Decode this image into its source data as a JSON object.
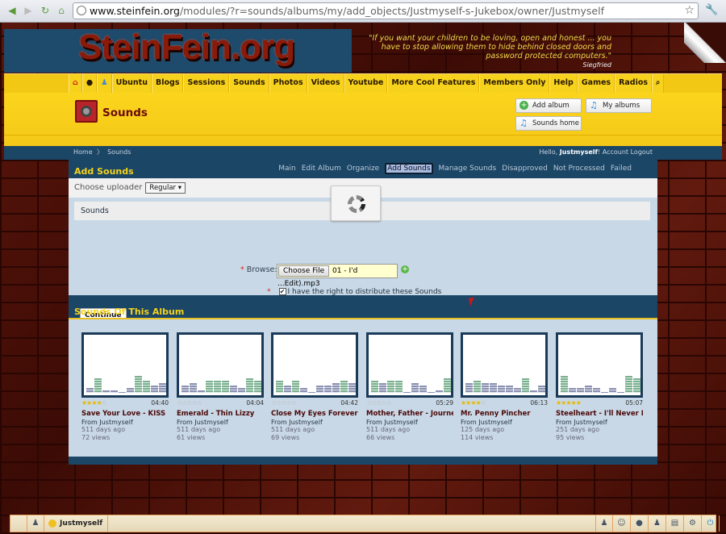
{
  "browser": {
    "url_domain": "www.steinfein.org",
    "url_path": "/modules/?r=sounds/albums/my/add_objects/Justmyself-s-Jukebox/owner/Justmyself"
  },
  "site": {
    "logo": "SteinFein.org",
    "quote": "\"If you want your children to be loving, open and honest ... you have to stop allowing them to hide behind closed doors and password protected computers.\"",
    "quote_author": "Siegfried"
  },
  "nav": [
    "Ubuntu",
    "Blogs",
    "Sessions",
    "Sounds",
    "Photos",
    "Videos",
    "Youtube",
    "More Cool Features",
    "Members Only",
    "Help",
    "Games",
    "Radios"
  ],
  "page": {
    "title": "Sounds",
    "add_album": "Add album",
    "my_albums": "My albums",
    "sounds_home": "Sounds home"
  },
  "breadcrumb": {
    "home": "Home",
    "sounds": "Sounds",
    "hello": "Hello,",
    "user": "Justmyself",
    "excl": "!",
    "account": "Account",
    "logout": "Logout"
  },
  "section": {
    "title": "Add Sounds",
    "tabs": [
      "Main",
      "Edit Album",
      "Organize",
      "Add Sounds",
      "Manage Sounds",
      "Disapproved",
      "Not Processed",
      "Failed"
    ],
    "active_tab": 3
  },
  "form": {
    "choose_uploader": "Choose uploader",
    "uploader": "Regular",
    "panel": "Sounds",
    "browse_label": "Browse:",
    "choose_file": "Choose File",
    "file_name": "01 - I'd ...Edit).mp3",
    "agree": "I have the right to distribute these Sounds",
    "agree_checked": true,
    "continue": "Continue"
  },
  "album": {
    "title": "Sounds Of This Album",
    "items": [
      {
        "title": "Save Your Love - KISS",
        "duration": "04:40",
        "rating": 4,
        "from": "From Justmyself",
        "age": "511 days ago",
        "views": "72 views"
      },
      {
        "title": "Emerald - Thin Lizzy",
        "duration": "04:04",
        "rating": 0,
        "from": "From Justmyself",
        "age": "511 days ago",
        "views": "61 views"
      },
      {
        "title": "Close My Eyes Forever",
        "duration": "04:42",
        "rating": 0,
        "from": "From Justmyself",
        "age": "511 days ago",
        "views": "69 views"
      },
      {
        "title": "Mother, Father - Journey",
        "duration": "05:29",
        "rating": 0,
        "from": "From Justmyself",
        "age": "511 days ago",
        "views": "66 views"
      },
      {
        "title": "Mr. Penny Pincher",
        "duration": "06:13",
        "rating": 4,
        "from": "From Justmyself",
        "age": "125 days ago",
        "views": "114 views"
      },
      {
        "title": "Steelheart - I'll Never Let",
        "duration": "05:07",
        "rating": 5,
        "from": "From Justmyself",
        "age": "251 days ago",
        "views": "95 views"
      }
    ]
  },
  "taskbar": {
    "user": "Justmyself"
  }
}
